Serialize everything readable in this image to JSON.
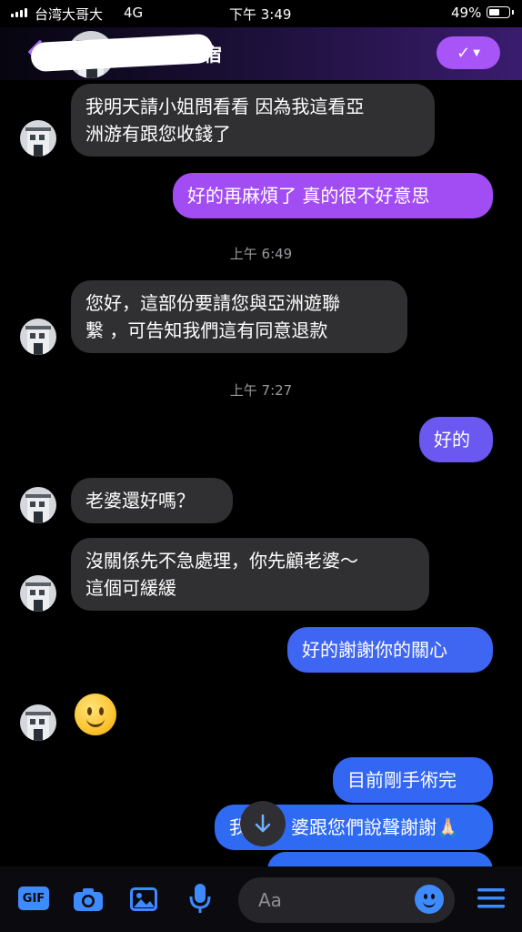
{
  "status_bar": {
    "carrier": "台湾大哥大",
    "network": "4G",
    "time": "下午 3:49",
    "battery_percent": "49%"
  },
  "header": {
    "title": "民宿",
    "action_icon": "check-dropdown-icon",
    "back_icon": "chevron-left-icon"
  },
  "colors": {
    "outgoing_top": "#a24df4",
    "outgoing_bottom": "#2f6bf2",
    "incoming": "#303033",
    "accent": "#3d8bff"
  },
  "messages": [
    {
      "id": "m1",
      "direction": "in",
      "lines": [
        "我明天請小姐問看看 因為我這看亞",
        "洲游有跟您收錢了"
      ]
    },
    {
      "id": "m2",
      "direction": "out",
      "lines": [
        "好的再麻煩了 真的很不好意思"
      ]
    },
    {
      "id": "t1",
      "timestamp": "上午 6:49"
    },
    {
      "id": "m3",
      "direction": "in",
      "lines": [
        "您好，這部份要請您與亞洲遊聯",
        "繫 ，可告知我們這有同意退款"
      ]
    },
    {
      "id": "t2",
      "timestamp": "上午 7:27"
    },
    {
      "id": "m4",
      "direction": "out",
      "lines": [
        "好的"
      ]
    },
    {
      "id": "m5",
      "direction": "in",
      "lines": [
        "老婆還好嗎？"
      ]
    },
    {
      "id": "m6",
      "direction": "in",
      "lines": [
        "沒關係先不急處理，你先顧老婆～",
        "這個可緩緩"
      ]
    },
    {
      "id": "m7",
      "direction": "out",
      "lines": [
        "好的謝謝你的關心"
      ]
    },
    {
      "id": "m8",
      "direction": "in",
      "emoji": "slightly-smiling-face"
    },
    {
      "id": "m9",
      "direction": "out",
      "lines": [
        "目前剛手術完"
      ]
    },
    {
      "id": "m10",
      "direction": "out",
      "lines": [
        "我",
        "婆跟您們說聲謝謝🙏🏻"
      ]
    }
  ],
  "composer": {
    "placeholder": "Aa",
    "gif_label": "GIF",
    "icons": [
      "gif-icon",
      "camera-icon",
      "image-icon",
      "microphone-icon",
      "emoji-icon",
      "menu-icon"
    ]
  },
  "scroll_icon": "arrow-down-icon"
}
